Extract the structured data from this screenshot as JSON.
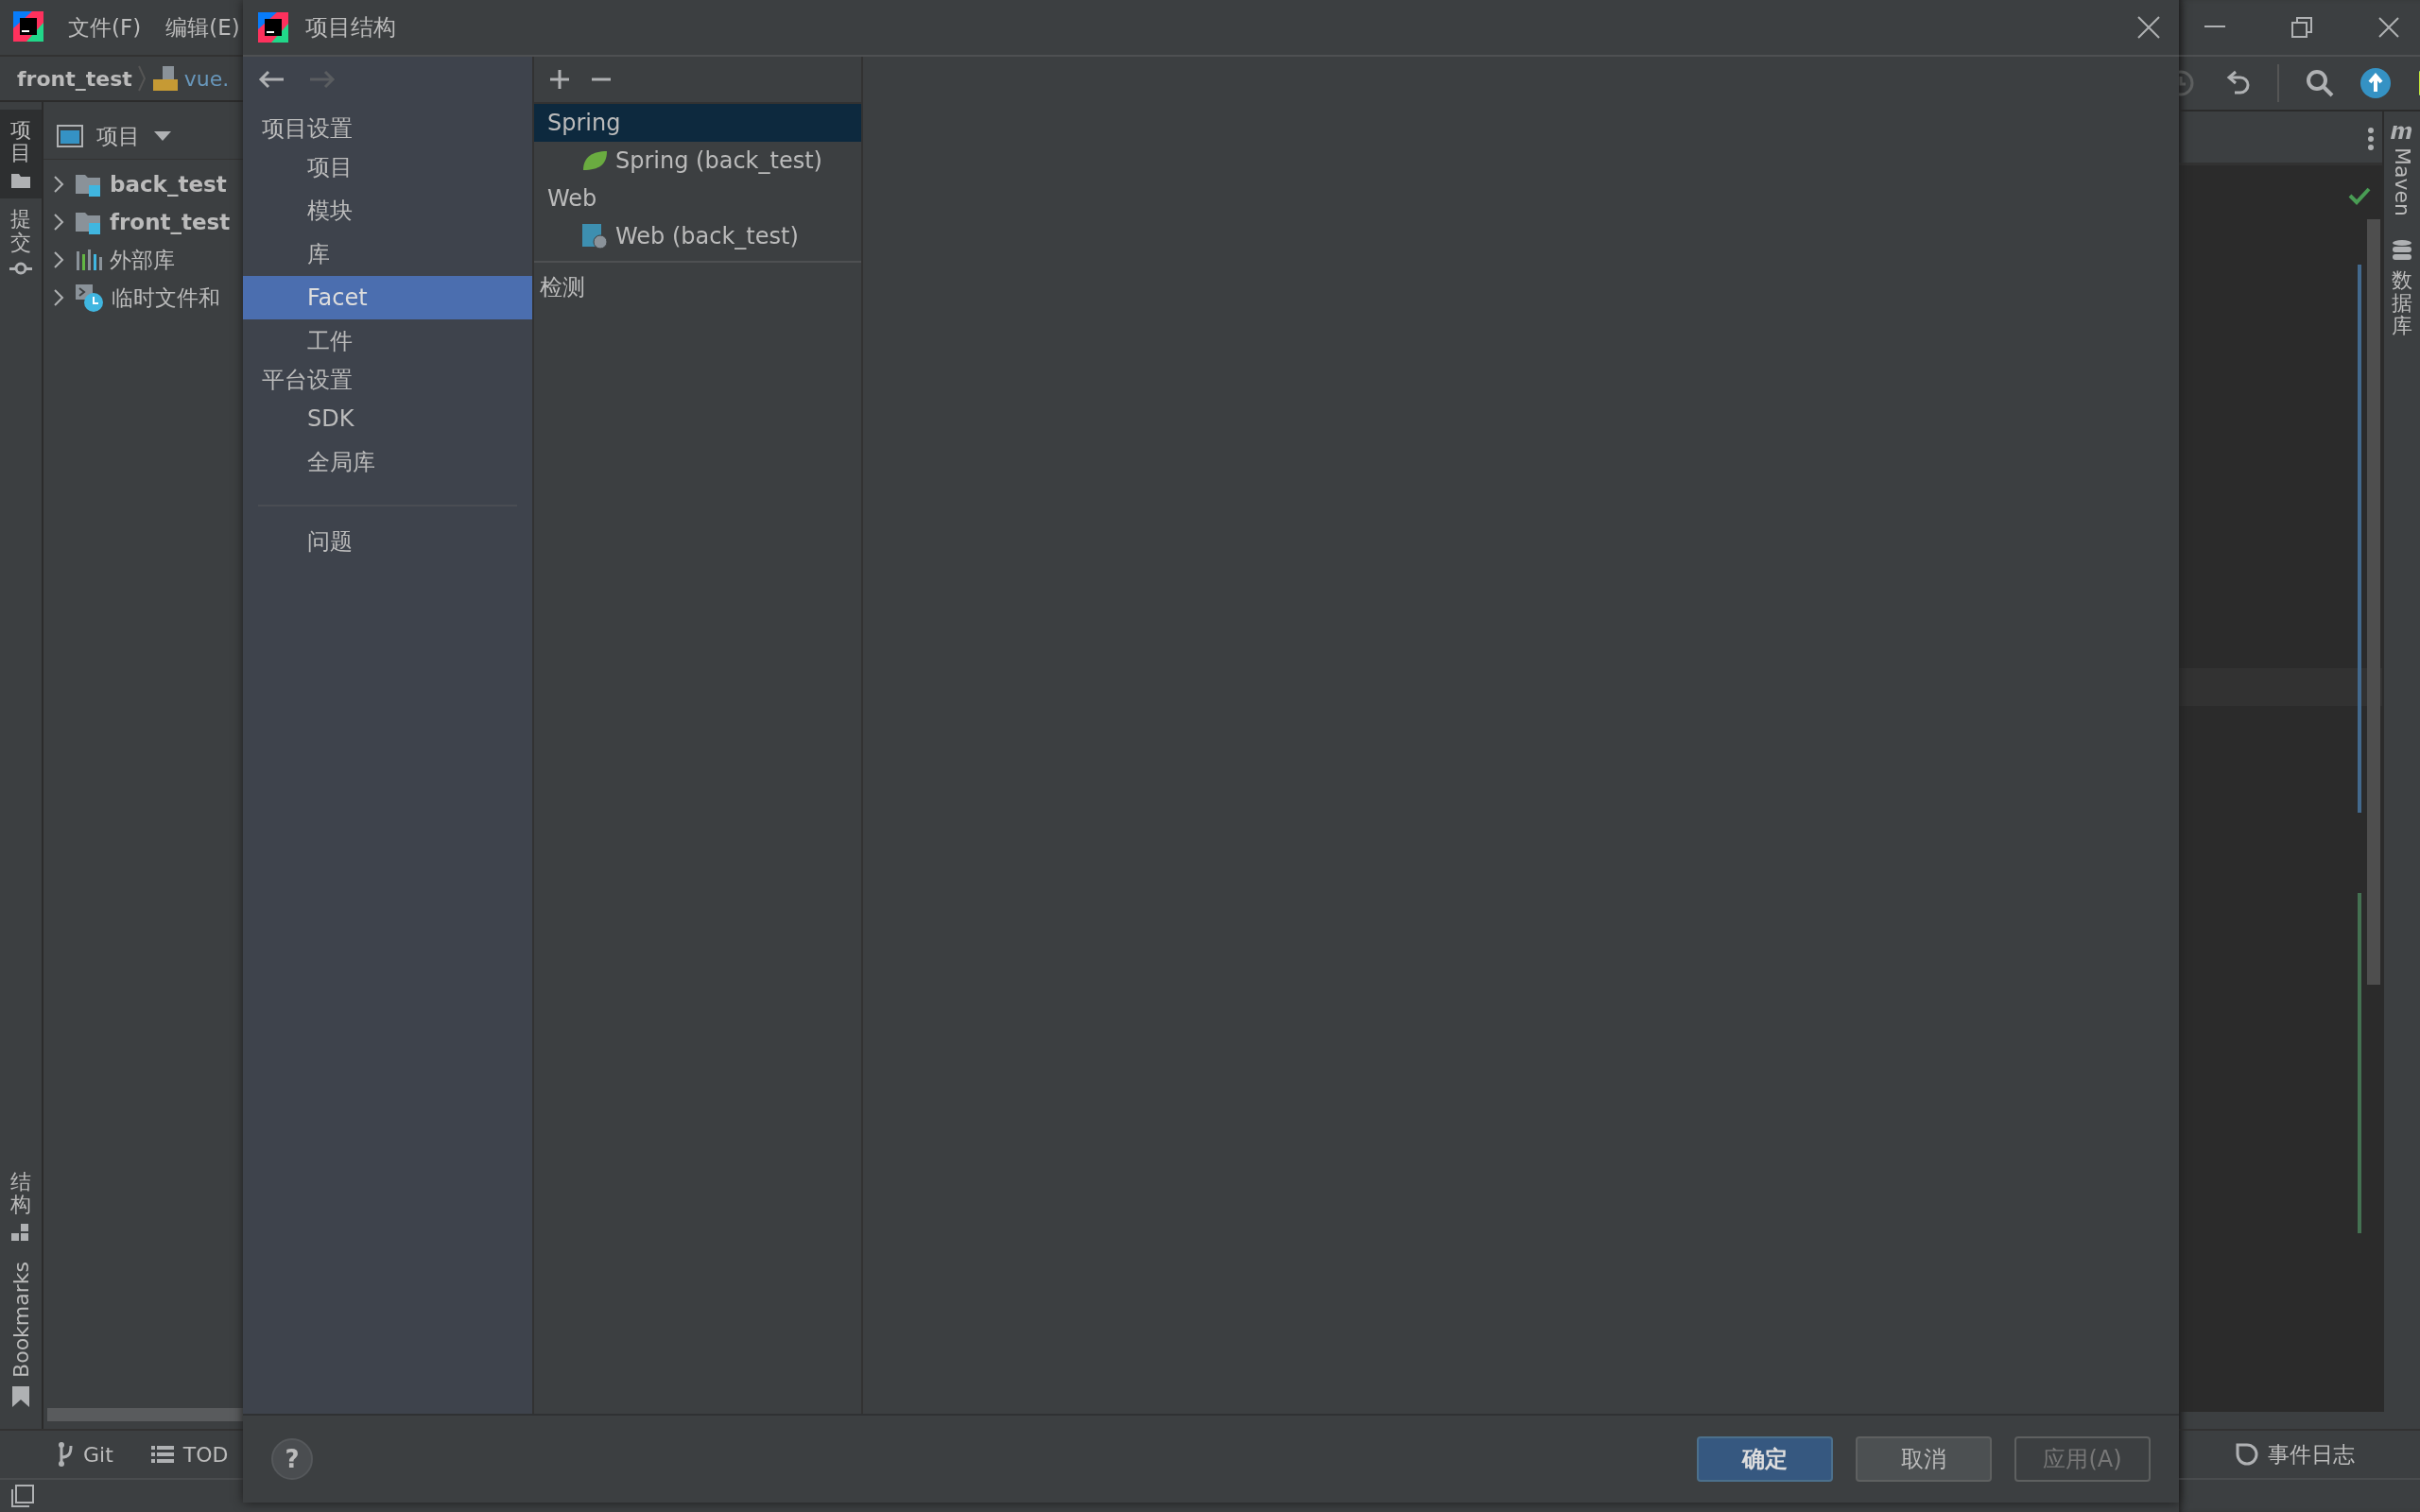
{
  "ide": {
    "menu": [
      "文件(F)",
      "编辑(E)"
    ],
    "breadcrumb": {
      "project": "front_test",
      "file": "vue."
    },
    "left_tool_windows": [
      {
        "label": "项目",
        "selected": true
      },
      {
        "label": "提交",
        "selected": false
      }
    ],
    "left_tool_windows_bottom": [
      {
        "label": "结构",
        "selected": false
      },
      {
        "label": "Bookmarks",
        "selected": false
      }
    ],
    "project_panel": {
      "title": "项目",
      "tree": [
        {
          "label": "back_test",
          "kind": "module",
          "expanded": false
        },
        {
          "label": "front_test",
          "kind": "module",
          "expanded": false
        },
        {
          "label": "外部库",
          "kind": "library",
          "expanded": false
        },
        {
          "label": "临时文件和",
          "kind": "scratch",
          "expanded": false
        }
      ]
    },
    "right_tool_windows": [
      "Maven",
      "数据库"
    ],
    "bottom_tool_windows": [
      "Git",
      "TOD"
    ],
    "event_log": "事件日志"
  },
  "dialog": {
    "title": "项目结构",
    "back_disabled": false,
    "forward_disabled": true,
    "sections": [
      {
        "heading": "项目设置",
        "items": [
          {
            "label": "项目",
            "selected": false
          },
          {
            "label": "模块",
            "selected": false
          },
          {
            "label": "库",
            "selected": false
          },
          {
            "label": "Facet",
            "selected": true
          },
          {
            "label": "工件",
            "selected": false
          }
        ]
      },
      {
        "heading": "平台设置",
        "items": [
          {
            "label": "SDK",
            "selected": false
          },
          {
            "label": "全局库",
            "selected": false
          }
        ]
      }
    ],
    "problems": {
      "label": "问题",
      "selected": false
    },
    "facet_tree": [
      {
        "label": "Spring",
        "selected": true,
        "children": [
          {
            "label": "Spring (back_test)",
            "kind": "spring",
            "selected": false
          }
        ]
      },
      {
        "label": "Web",
        "selected": false,
        "children": [
          {
            "label": "Web (back_test)",
            "kind": "web",
            "selected": false
          }
        ]
      }
    ],
    "detection": "检测",
    "help": "?",
    "buttons": [
      {
        "label": "确定",
        "kind": "primary",
        "disabled": false
      },
      {
        "label": "取消",
        "kind": "normal",
        "disabled": false
      },
      {
        "label": "应用(A)",
        "kind": "normal",
        "disabled": true
      }
    ]
  }
}
